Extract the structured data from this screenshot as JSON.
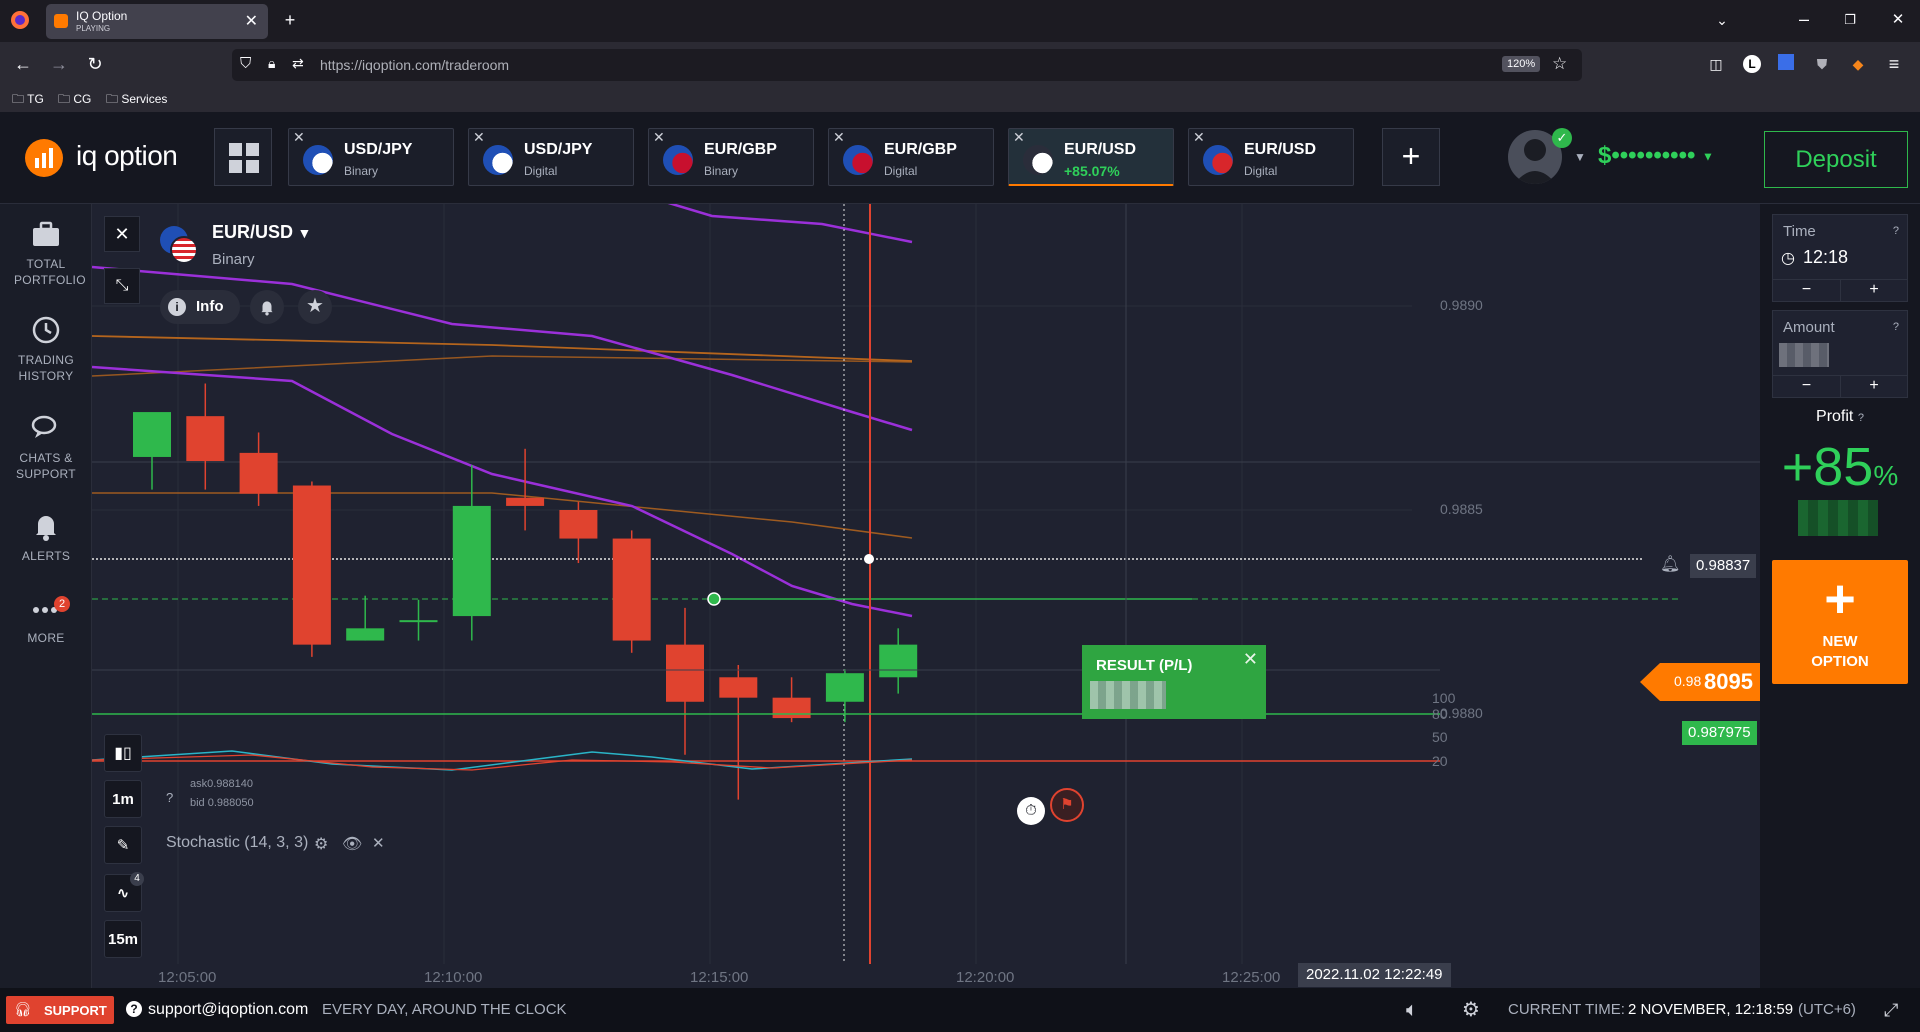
{
  "browser": {
    "tab_title": "IQ Option",
    "tab_subtitle": "PLAYING",
    "url": "https://iqoption.com/traderoom",
    "zoom": "120%",
    "bookmarks": [
      "TG",
      "CG",
      "Services"
    ]
  },
  "header": {
    "logo_text": "iq option",
    "balance": "$••••••••••",
    "deposit_label": "Deposit",
    "asset_tabs": [
      {
        "name": "USD/JPY",
        "sub": "Binary",
        "active": false
      },
      {
        "name": "USD/JPY",
        "sub": "Digital",
        "active": false
      },
      {
        "name": "EUR/GBP",
        "sub": "Binary",
        "active": false
      },
      {
        "name": "EUR/GBP",
        "sub": "Digital",
        "active": false
      },
      {
        "name": "EUR/USD",
        "sub": "+85.07%",
        "active": true
      },
      {
        "name": "EUR/USD",
        "sub": "Digital",
        "active": false
      }
    ]
  },
  "sidebar": {
    "items": [
      {
        "label": "TOTAL PORTFOLIO",
        "icon": "briefcase-icon"
      },
      {
        "label": "TRADING HISTORY",
        "icon": "history-icon"
      },
      {
        "label": "CHATS & SUPPORT",
        "icon": "chat-icon"
      },
      {
        "label": "ALERTS",
        "icon": "bell-icon"
      },
      {
        "label": "MORE",
        "icon": "more-icon",
        "badge": "2"
      }
    ]
  },
  "chart": {
    "asset_name": "EUR/USD",
    "asset_type": "Binary",
    "info_label": "Info",
    "ask": "ask0.988140",
    "bid": "bid 0.988050",
    "timeframe_1": "1m",
    "timeframe_2": "15m",
    "indicator_badge": "4",
    "indicator_name": "Stochastic (14, 3, 3)",
    "price_levels": [
      "0.9890",
      "0.9885",
      "0.9880"
    ],
    "alert_price": "0.98837",
    "current_price_prefix": "0.98",
    "current_price_main": "8095",
    "entry_price": "0.987975",
    "result_label": "RESULT (P/L)",
    "stoch_levels": [
      "100",
      "80",
      "50",
      "20"
    ],
    "time_labels": [
      "12:05:00",
      "12:10:00",
      "12:15:00",
      "12:20:00",
      "12:25:00"
    ],
    "expiry_label": "2022.11.02 12:22:49",
    "colors": {
      "up": "#2fb84c",
      "down": "#e0432f",
      "purple": "#9b30d9",
      "orange": "#b5651d",
      "accent": "#ff7a00"
    }
  },
  "chart_data": {
    "type": "candlestick",
    "ylim": [
      0.98775,
      0.98915
    ],
    "candles": [
      {
        "o": 0.98863,
        "h": 0.98868,
        "l": 0.98855,
        "c": 0.98874
      },
      {
        "o": 0.98873,
        "h": 0.98881,
        "l": 0.98855,
        "c": 0.98862
      },
      {
        "o": 0.98864,
        "h": 0.98869,
        "l": 0.98851,
        "c": 0.98854
      },
      {
        "o": 0.98856,
        "h": 0.98857,
        "l": 0.98814,
        "c": 0.98817
      },
      {
        "o": 0.98818,
        "h": 0.98829,
        "l": 0.98818,
        "c": 0.98821
      },
      {
        "o": 0.98823,
        "h": 0.98828,
        "l": 0.98818,
        "c": 0.98823
      },
      {
        "o": 0.98824,
        "h": 0.98861,
        "l": 0.98818,
        "c": 0.98851
      },
      {
        "o": 0.98853,
        "h": 0.98865,
        "l": 0.98845,
        "c": 0.98851
      },
      {
        "o": 0.9885,
        "h": 0.98852,
        "l": 0.98837,
        "c": 0.98843
      },
      {
        "o": 0.98843,
        "h": 0.98845,
        "l": 0.98815,
        "c": 0.98818
      },
      {
        "o": 0.98817,
        "h": 0.98826,
        "l": 0.9879,
        "c": 0.98803
      },
      {
        "o": 0.98809,
        "h": 0.98812,
        "l": 0.98779,
        "c": 0.98804
      },
      {
        "o": 0.98804,
        "h": 0.98809,
        "l": 0.98798,
        "c": 0.98799
      },
      {
        "o": 0.98803,
        "h": 0.98811,
        "l": 0.98798,
        "c": 0.9881
      },
      {
        "o": 0.98809,
        "h": 0.98821,
        "l": 0.98805,
        "c": 0.98817
      }
    ]
  },
  "right_panel": {
    "time_label": "Time",
    "time_value": "12:18",
    "amount_label": "Amount",
    "profit_label": "Profit",
    "profit_value": "+85",
    "profit_unit": "%",
    "new_option_label": "NEW OPTION"
  },
  "footer": {
    "support_label": "SUPPORT",
    "support_email": "support@iqoption.com",
    "support_hours": "EVERY DAY, AROUND THE CLOCK",
    "current_time_label": "CURRENT TIME:",
    "current_time_value": "2 NOVEMBER, 12:18:59",
    "timezone": "(UTC+6)"
  }
}
